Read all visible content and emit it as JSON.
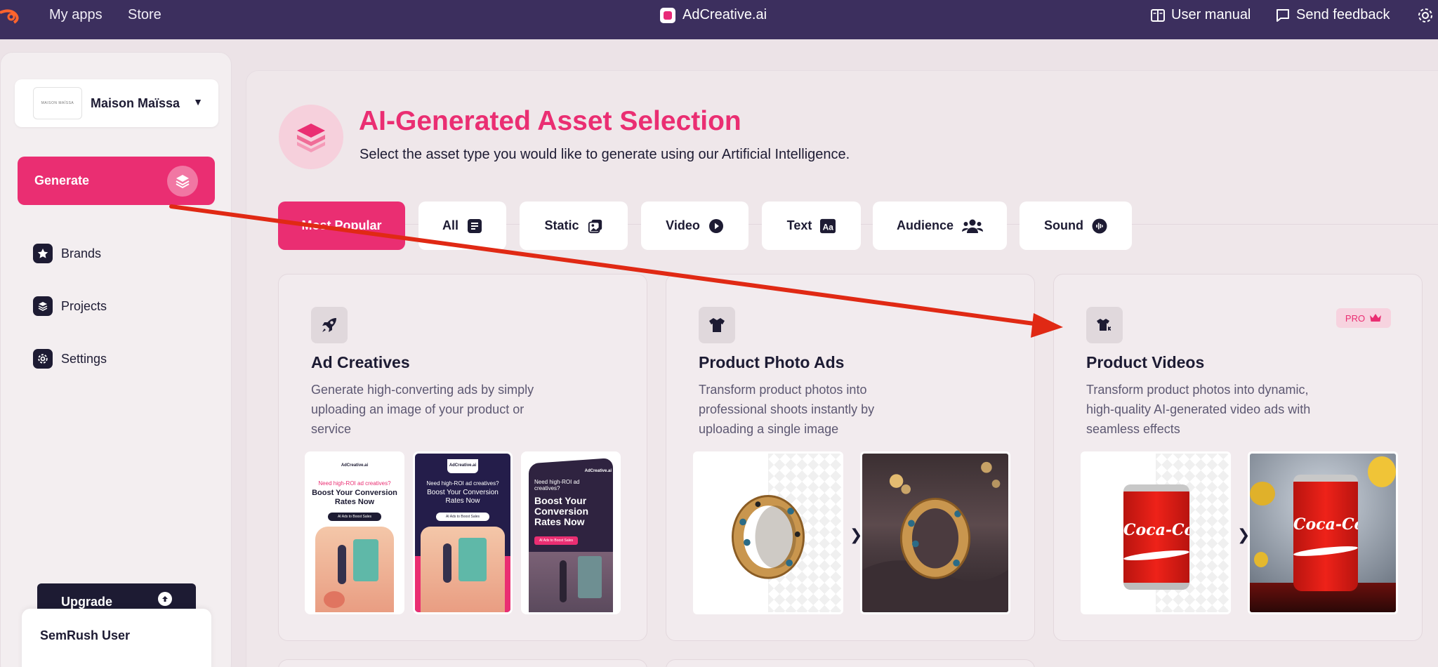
{
  "topbar": {
    "my_apps": "My apps",
    "store": "Store",
    "app_title": "AdCreative.ai",
    "user_manual": "User manual",
    "send_feedback": "Send feedback"
  },
  "sidebar": {
    "brand_name": "Maison Maïssa",
    "brand_logo_text": "MAISON MAÏSSA",
    "generate_label": "Generate",
    "items": [
      {
        "label": "Brands",
        "icon": "star-icon"
      },
      {
        "label": "Projects",
        "icon": "layers-icon"
      },
      {
        "label": "Settings",
        "icon": "gear-icon"
      }
    ],
    "upgrade_label": "Upgrade",
    "user_name": "SemRush User"
  },
  "main": {
    "title": "AI-Generated Asset Selection",
    "subtitle": "Select the asset type you would like to generate using our Artificial Intelligence.",
    "tabs": [
      {
        "label": "Most Popular",
        "icon": ""
      },
      {
        "label": "All",
        "icon": "list-icon"
      },
      {
        "label": "Static",
        "icon": "images-icon"
      },
      {
        "label": "Video",
        "icon": "play-icon"
      },
      {
        "label": "Text",
        "icon": "text-icon"
      },
      {
        "label": "Audience",
        "icon": "users-icon"
      },
      {
        "label": "Sound",
        "icon": "sound-icon"
      }
    ],
    "cards": [
      {
        "title": "Ad Creatives",
        "description": "Generate high-converting ads by simply uploading an image of your product or service",
        "icon": "rocket-icon",
        "badge": "",
        "ad_brand": "AdCreative.ai",
        "ad_small_1": "Need high-ROI ad creatives?",
        "ad_head_1": "Boost Your Conversion Rates Now",
        "ad_small_3": "Need high-ROI ad creatives?",
        "ad_head_3": "Boost Your Conversion Rates Now",
        "ad_cta": "AI Ads to Boost Sales"
      },
      {
        "title": "Product Photo Ads",
        "description": "Transform product photos into professional shoots instantly by uploading a single image",
        "icon": "shirt-icon",
        "badge": ""
      },
      {
        "title": "Product Videos",
        "description": "Transform product photos into dynamic, high-quality AI-generated video ads with seamless effects",
        "icon": "video-shirt-icon",
        "badge": "PRO",
        "can_label": "Coca-Col"
      }
    ]
  },
  "colors": {
    "accent": "#ea2e72",
    "topbar": "#3c2f5e",
    "dark": "#1d1b33",
    "annotation_arrow": "#e02914"
  }
}
